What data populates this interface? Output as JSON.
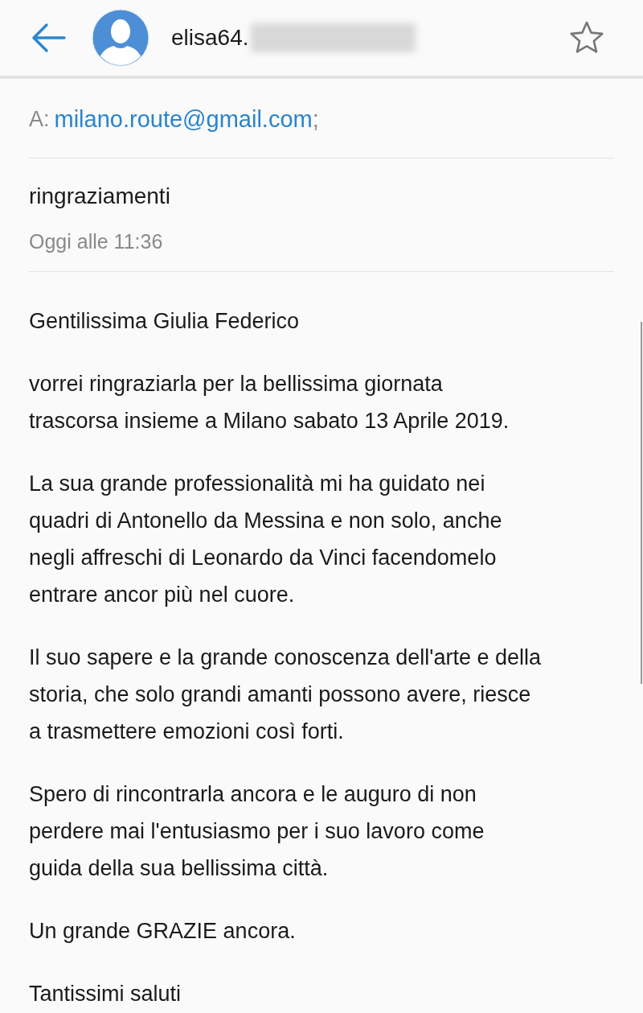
{
  "header": {
    "sender": "elisa64.",
    "starred": false
  },
  "recipient": {
    "label": "A:",
    "address": "milano.route@gmail.com",
    "separator": ";"
  },
  "subject": "ringraziamenti",
  "date": "Oggi alle 11:36",
  "body": [
    {
      "lines": [
        "Gentilissima Giulia Federico"
      ]
    },
    {
      "lines": [
        "vorrei ringraziarla per la bellissima giornata",
        "trascorsa insieme a Milano sabato 13 Aprile 2019."
      ]
    },
    {
      "lines": [
        "La sua grande professionalità mi ha guidato nei",
        "quadri di Antonello da Messina e non solo, anche",
        "negli affreschi di Leonardo da Vinci facendomelo",
        "entrare ancor più nel cuore."
      ]
    },
    {
      "lines": [
        "Il suo sapere e la grande conoscenza dell'arte e della",
        "storia, che solo grandi amanti possono avere, riesce",
        "a trasmettere emozioni così forti."
      ]
    },
    {
      "lines": [
        "Spero di rincontrarla ancora e le auguro di non",
        "perdere mai l'entusiasmo per i suo lavoro come",
        "guida della sua bellissima città."
      ]
    },
    {
      "lines": [
        "Un grande GRAZIE ancora."
      ]
    },
    {
      "lines": [
        "Tantissimi saluti"
      ]
    }
  ]
}
